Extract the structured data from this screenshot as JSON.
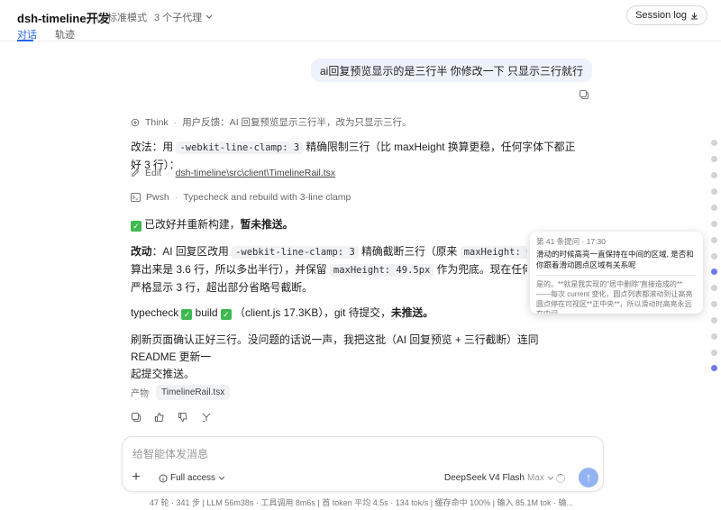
{
  "header": {
    "title": "dsh-timeline开发",
    "mode_label": "标准模式",
    "agents_label": "3 个子代理",
    "session_log_label": "Session log",
    "tabs": [
      "对话",
      "轨迹"
    ]
  },
  "user_message": "ai回复预览显示的是三行半 你修改一下 只显示三行就行",
  "steps": {
    "think_label": "Think",
    "think_text": "用户反馈：AI 回复预览显示三行半，改为只显示三行。",
    "edit_label": "Edit",
    "edit_path": "dsh-timeline\\src\\client\\TimelineRail.tsx",
    "pwsh_label": "Pwsh",
    "pwsh_text": "Typecheck and rebuild with 3-line clamp"
  },
  "reply": {
    "p1_a": "改法：用 ",
    "p1_code": "-webkit-line-clamp: 3",
    "p1_b": " 精确限制三行（比 maxHeight 换算更稳，任何字体下都正好 3 行）：",
    "status_a": "已改好并重新构建，",
    "status_b": "暂未推送。",
    "p2_label": "改动",
    "p2_a": "：AI 回复区改用 ",
    "p2_code1": "-webkit-line-clamp: 3",
    "p2_b": " 精确截断三行（原来 ",
    "p2_code2": "maxHeight: 60px",
    "p2_c": " 按",
    "p2_line2_a": "算出来是 3.6 行，所以多出半行），并保留 ",
    "p2_code3": "maxHeight: 49.5px",
    "p2_line2_b": " 作为兜底。现在任何字号/",
    "p2_line3": "严格显示 3 行，超出部分省略号截断。",
    "p3_a": "typecheck ",
    "p3_b": " build ",
    "p3_c": " （client.js 17.3KB），git 待提交，",
    "p3_d": "未推送。",
    "p4_line1": "刷新页面确认正好三行。没问题的话说一声，我把这批（AI 回复预览 + 三行截断）连同 README 更新一",
    "p4_line2": "起提交推送。"
  },
  "artifact": {
    "label": "产物",
    "file": "TimelineRail.tsx"
  },
  "tooltip": {
    "meta": "第 41 条提问 · 17:30",
    "question": "滑动的时候高亮一直保持在中间的区域, 是否和你跟着滑动圆点区域有关系呢",
    "answer": "是的。**就是我实现的\"居中删除\"直接造成的**——每次 current 变化，圆点列表都滚动到让高亮圆点停在可视区**正中央**，所以滑动时高亮永远在中间。 ..."
  },
  "composer": {
    "placeholder": "给智能体发消息",
    "access_label": "Full access",
    "model_label": "DeepSeek V4 Flash",
    "model_sub": "Max"
  },
  "statusbar": "47 轮 · 341 步   |   LLM 56m38s · 工具调用 8m6s   |   首 token 平均 4.5s · 134 tok/s   |   缓存命中 100%   |   输入 85.1M tok · 输..."
}
